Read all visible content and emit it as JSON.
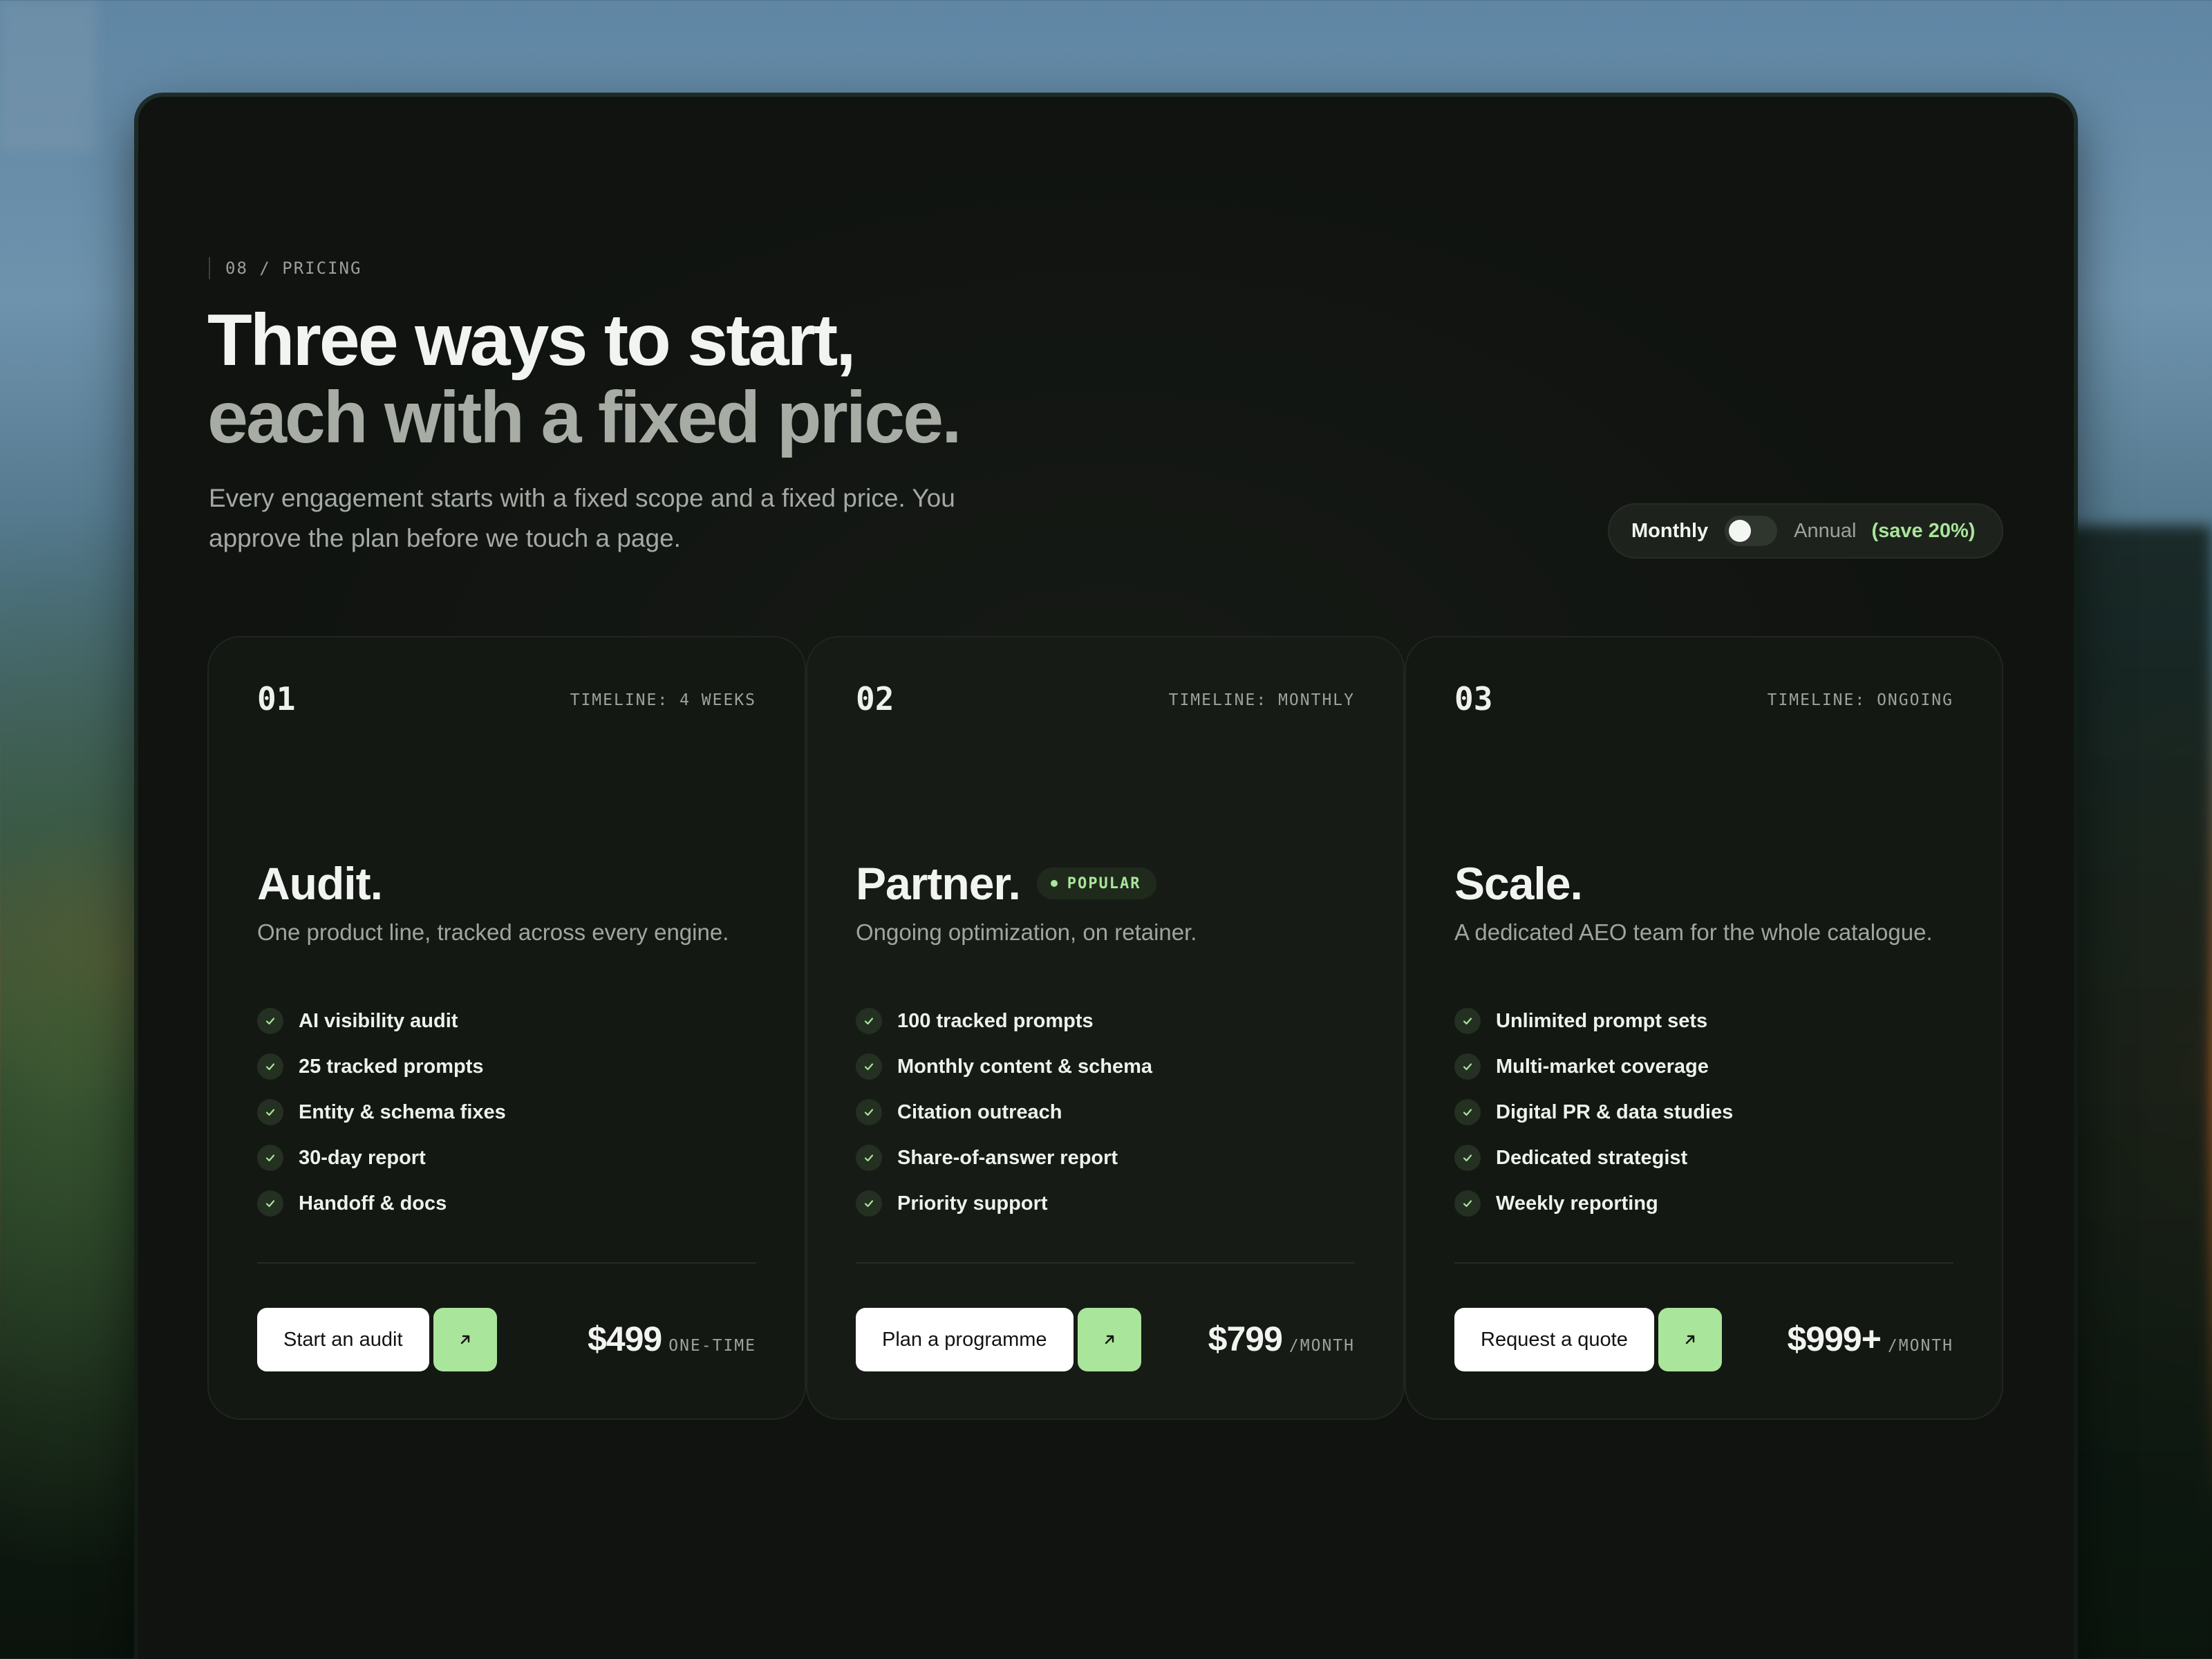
{
  "section": {
    "tag": "08 / PRICING",
    "headline_line1": "Three ways to start,",
    "headline_line2": "each with a fixed price.",
    "lede": "Every engagement starts with a fixed scope and a fixed price. You approve the plan before we touch a page."
  },
  "billing": {
    "monthly_label": "Monthly",
    "annual_label": "Annual",
    "save_label": "(save 20%)",
    "selected": "Monthly"
  },
  "plans": [
    {
      "number": "01",
      "timeline": "TIMELINE: 4 WEEKS",
      "name": "Audit.",
      "description": "One product line, tracked across every engine.",
      "features": [
        "AI visibility audit",
        "25 tracked prompts",
        "Entity & schema fixes",
        "30-day report",
        "Handoff & docs"
      ],
      "cta_label": "Start an audit",
      "price": "$499",
      "period": "ONE-TIME"
    },
    {
      "number": "02",
      "timeline": "TIMELINE: MONTHLY",
      "name": "Partner.",
      "badge": "POPULAR",
      "description": "Ongoing optimization, on retainer.",
      "features": [
        "100 tracked prompts",
        "Monthly content & schema",
        "Citation outreach",
        "Share-of-answer report",
        "Priority support"
      ],
      "cta_label": "Plan a programme",
      "price": "$799",
      "period": "/MONTH"
    },
    {
      "number": "03",
      "timeline": "TIMELINE: ONGOING",
      "name": "Scale.",
      "description": "A dedicated AEO team for the whole catalogue.",
      "features": [
        "Unlimited prompt sets",
        "Multi-market coverage",
        "Digital PR & data studies",
        "Dedicated strategist",
        "Weekly reporting"
      ],
      "cta_label": "Request a quote",
      "price": "$999+",
      "period": "/MONTH"
    }
  ],
  "colors": {
    "accent": "#a9e59a",
    "card_bg": "#141813",
    "text_primary": "#f2f4f1",
    "text_muted": "#a0a69f"
  },
  "icons": {
    "feature": "check-icon",
    "cta": "arrow-up-right-icon"
  }
}
